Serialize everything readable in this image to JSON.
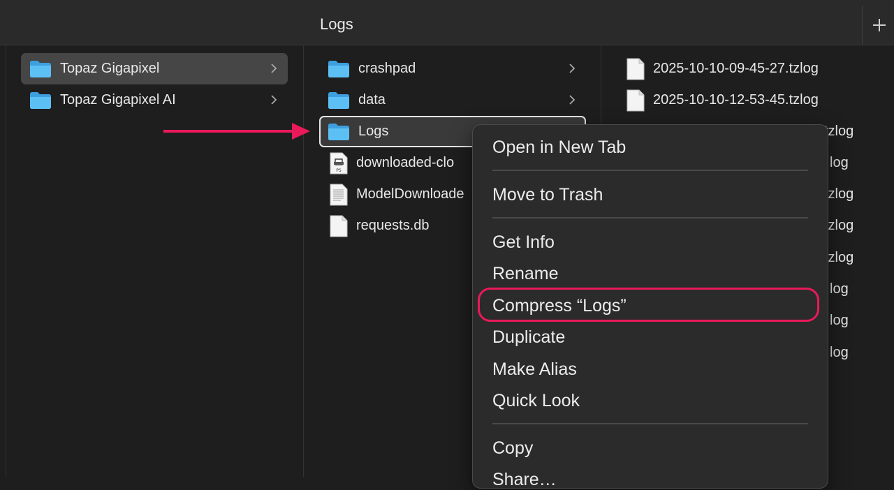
{
  "window": {
    "title": "Logs"
  },
  "toolbar": {
    "add_tab_icon": "plus-icon"
  },
  "column2": {
    "items": [
      {
        "label": "Topaz Gigapixel",
        "icon": "folder-icon",
        "selected": true
      },
      {
        "label": "Topaz Gigapixel AI",
        "icon": "folder-icon",
        "selected": false
      }
    ]
  },
  "column3": {
    "items": [
      {
        "label": "crashpad",
        "icon": "folder-icon"
      },
      {
        "label": "data",
        "icon": "folder-icon"
      },
      {
        "label": "Logs",
        "icon": "folder-icon",
        "selected": true
      },
      {
        "label": "downloaded-clo",
        "icon": "postscript-doc-icon"
      },
      {
        "label": "ModelDownloade",
        "icon": "text-doc-icon"
      },
      {
        "label": "requests.db",
        "icon": "blank-doc-icon"
      }
    ]
  },
  "column4": {
    "items": [
      {
        "label": "2025-10-10-09-45-27.tzlog"
      },
      {
        "label": "2025-10-10-12-53-45.tzlog"
      },
      {
        "label": "tzlog"
      },
      {
        "label": "log"
      },
      {
        "label": "tzlog"
      },
      {
        "label": "tzlog"
      },
      {
        "label": "tzlog"
      },
      {
        "label": "log"
      },
      {
        "label": "log"
      },
      {
        "label": "log"
      }
    ]
  },
  "context_menu": {
    "items": [
      "Open in New Tab",
      "Move to Trash",
      "Get Info",
      "Rename",
      "Compress “Logs”",
      "Duplicate",
      "Make Alias",
      "Quick Look",
      "Copy",
      "Share…"
    ]
  },
  "colors": {
    "folder": "#4fb3f0",
    "highlight": "#ea1a5a",
    "annotation_arrow": "#ea1a5a"
  }
}
